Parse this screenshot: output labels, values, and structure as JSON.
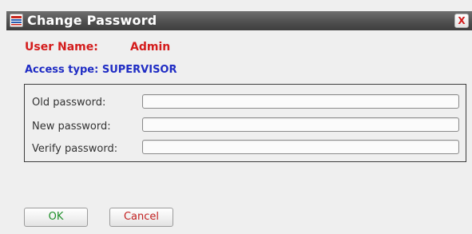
{
  "window": {
    "title": "Change Password",
    "icon": "app-logo-icon",
    "close_label": "X"
  },
  "user": {
    "label": "User Name:",
    "value": "Admin"
  },
  "access": {
    "text": "Access type: SUPERVISOR"
  },
  "fields": {
    "old_password": {
      "label": "Old password:",
      "value": "",
      "placeholder": ""
    },
    "new_password": {
      "label": "New password:",
      "value": "",
      "placeholder": ""
    },
    "verify_password": {
      "label": "Verify password:",
      "value": "",
      "placeholder": ""
    }
  },
  "buttons": {
    "ok_label": "OK",
    "cancel_label": "Cancel"
  },
  "colors": {
    "user_text": "#d41c1c",
    "access_text": "#1f2cc4",
    "ok_text": "#1f8f2a",
    "cancel_text": "#c21f1f",
    "titlebar": "#505050",
    "close_x": "#d21a1a"
  }
}
